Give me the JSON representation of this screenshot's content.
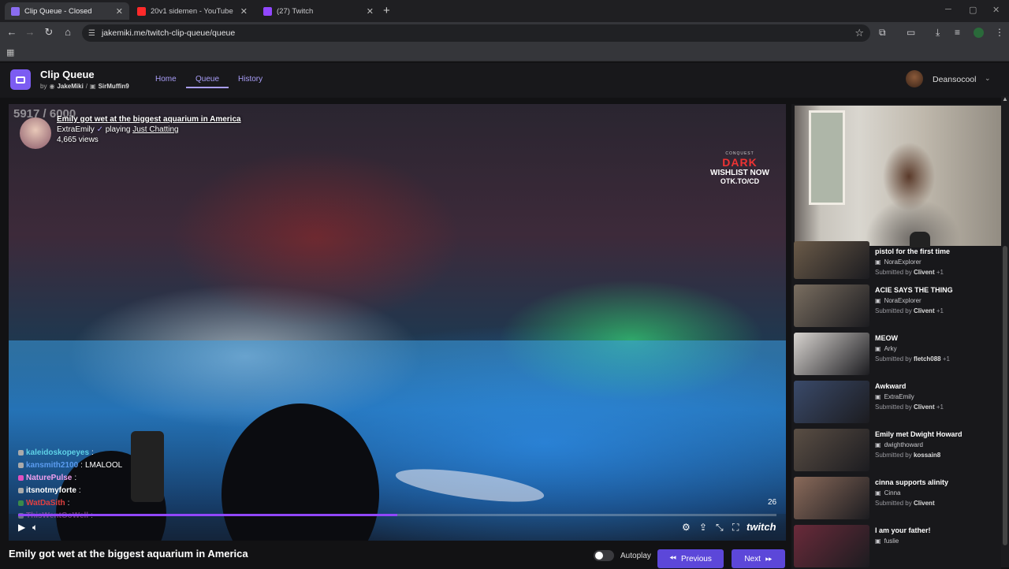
{
  "browser": {
    "tabs": [
      {
        "title": "Clip Queue - Closed",
        "favicon_color": "#8a6cf0",
        "close": "✕"
      },
      {
        "title": "20v1 sidemen - YouTube",
        "favicon_color": "#ff2a2a",
        "close": "✕"
      },
      {
        "title": "(27) Twitch",
        "favicon_color": "#9147ff",
        "close": "✕"
      }
    ],
    "new_tab": "+",
    "url": "jakemiki.me/twitch-clip-queue/queue"
  },
  "app": {
    "title": "Clip Queue",
    "by": "by",
    "author1": "JakeMiki",
    "separator": "/",
    "author2": "SirMuffin9",
    "nav": [
      "Home",
      "Queue",
      "History"
    ],
    "user": "Deansocool"
  },
  "player": {
    "counter": "5917 / 6000",
    "clip_title": "Emily got wet at the biggest aquarium in America",
    "streamer": "ExtraEmily",
    "playing": "playing",
    "category": "Just Chatting",
    "views": "4,665 views",
    "sponsor_top": "CONQUEST",
    "sponsor_name": "DARK",
    "sponsor_line": "WISHLIST NOW",
    "sponsor_url": "OTK.TO/CD",
    "time": "26",
    "progress": 0.5,
    "brand": "twitch",
    "chat": [
      {
        "user": "kaleidoskopeyes",
        "sep": ":",
        "msg": "",
        "color": "#5fd2e6"
      },
      {
        "user": "kansmith2100",
        "sep": ":",
        "msg": "LMALOOL",
        "color": "#5b9cf0"
      },
      {
        "user": "NaturePulse",
        "sep": ":",
        "msg": "",
        "color": "#f0a0f0"
      },
      {
        "user": "itsnotmyforte",
        "sep": ":",
        "msg": "",
        "color": "#ffffff"
      },
      {
        "user": "WatDaSith",
        "sep": ":",
        "msg": "",
        "color": "#e04040"
      },
      {
        "user": "ThisWentGoWell",
        "sep": ":",
        "msg": "",
        "color": "#c060c0"
      }
    ]
  },
  "queue": [
    {
      "title": "pistol for the first time",
      "streamer": "NoraExplorer",
      "submitted_by": "Submitted by",
      "submitter": "Clivent",
      "extra": "+1",
      "thumb": "#6a5a48"
    },
    {
      "title": "ACIE SAYS THE THING",
      "streamer": "NoraExplorer",
      "submitted_by": "Submitted by",
      "submitter": "Clivent",
      "extra": "+1",
      "thumb": "#7a6e60"
    },
    {
      "title": "MEOW",
      "streamer": "Arky",
      "submitted_by": "Submitted by",
      "submitter": "fletch088",
      "extra": "+1",
      "thumb": "#d8d4d0"
    },
    {
      "title": "Awkward",
      "streamer": "ExtraEmily",
      "submitted_by": "Submitted by",
      "submitter": "Clivent",
      "extra": "+1",
      "thumb": "#3a4a6a"
    },
    {
      "title": "Emily met Dwight Howard",
      "streamer": "dwighthoward",
      "submitted_by": "Submitted by",
      "submitter": "kossain8",
      "extra": "",
      "thumb": "#5a4e44"
    },
    {
      "title": "cinna supports alinity",
      "streamer": "Cinna",
      "submitted_by": "Submitted by",
      "submitter": "Clivent",
      "extra": "",
      "thumb": "#8a6a5a"
    },
    {
      "title": "I am your father!",
      "streamer": "fuslie",
      "submitted_by": "",
      "submitter": "",
      "extra": "",
      "thumb": "#6a2a3a"
    }
  ],
  "bottom": {
    "title": "Emily got wet at the biggest aquarium in America",
    "autoplay": "Autoplay",
    "previous": "Previous",
    "next": "Next"
  },
  "colors": {
    "accent": "#5c47d9",
    "brand": "#7c5cf2",
    "progress": "#9147ff"
  }
}
